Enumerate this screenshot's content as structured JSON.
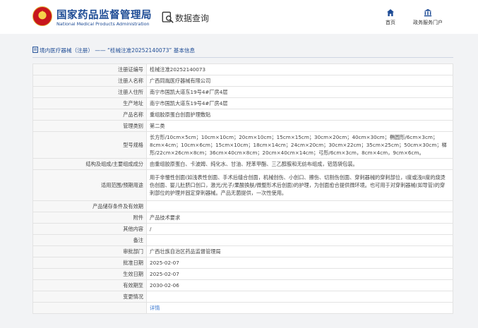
{
  "header": {
    "logo_cn": "国家药品监督管理局",
    "logo_en": "National Medical Products Administration",
    "query_title": "数据查询",
    "nav": [
      {
        "label": "首页",
        "icon": "home-icon"
      },
      {
        "label": "政务服务门户",
        "icon": "building-icon"
      }
    ]
  },
  "breadcrumb": {
    "text": "境内医疗器械（注册） —— “桂械注准20252140073” 基本信息"
  },
  "colors": {
    "brand_blue": "#1d4b95",
    "link_blue": "#3a78d0",
    "label_bg": "#f7f7f7"
  },
  "table": {
    "rows": [
      {
        "key": "注册证编号",
        "value": "桂械注准20252140073"
      },
      {
        "key": "注册人名称",
        "value": "广西同胤医疗器械有限公司"
      },
      {
        "key": "注册人住所",
        "value": "南宁市国凯大道东19号4#厂房4层"
      },
      {
        "key": "生产地址",
        "value": "南宁市国凯大道东19号4#厂房4层"
      },
      {
        "key": "产品名称",
        "value": "重组胶原蛋白创面护理敷贴"
      },
      {
        "key": "管理类别",
        "value": "第二类"
      },
      {
        "key": "型号规格",
        "value": "长方形/10cm×5cm；10cm×10cm；20cm×10cm；15cm×15cm；30cm×20cm；40cm×30cm；椭圆形/6cm×3cm；8cm×4cm；10cm×6cm；15cm×10cm；18cm×14cm；24cm×20cm；30cm×22cm；35cm×25cm；50cm×30cm；梯形/22cm×26cm×8cm；36cm×40cm×8cm；20cm×40cm×14cm；弓形/6cm×3cm，8cm×4cm，9cm×6cm。"
      },
      {
        "key": "结构及组成/主要组成成分",
        "value": "由重组胶原蛋白、卡波姆、纯化水、甘油、羟苯甲酯、三乙醇胺和无纺布组成，铝箔袋包装。"
      },
      {
        "key": "适用范围/预期用途",
        "value": "用于非慢性创面(如浅表性创面、手术后缝合创面，机械创伤、小创口、擦伤、切割伤创面、穿刺器械的穿刺部位，I度或浅II度的烧烫伤创面、婴儿肚脐口创口，激光/光子/果酸换肤/微整形术后创面)的护理，为创面愈合提供微环境。也可用于对穿刺器械(如导管)的穿刺部位的护理并固定穿刺器械。产品无菌提供，一次性使用。"
      },
      {
        "key": "产品储存条件及有效期",
        "value": ""
      },
      {
        "key": "附件",
        "value": "产品技术要求"
      },
      {
        "key": "其他内容",
        "value": "/"
      },
      {
        "key": "备注",
        "value": ""
      },
      {
        "key": "审批部门",
        "value": "广西壮族自治区药品监督管理局"
      },
      {
        "key": "批准日期",
        "value": "2025-02-07"
      },
      {
        "key": "生效日期",
        "value": "2025-02-07"
      },
      {
        "key": "有效期至",
        "value": "2030-02-06"
      },
      {
        "key": "变更情况",
        "value": ""
      },
      {
        "key": "",
        "value": "详情",
        "link": true
      }
    ]
  }
}
